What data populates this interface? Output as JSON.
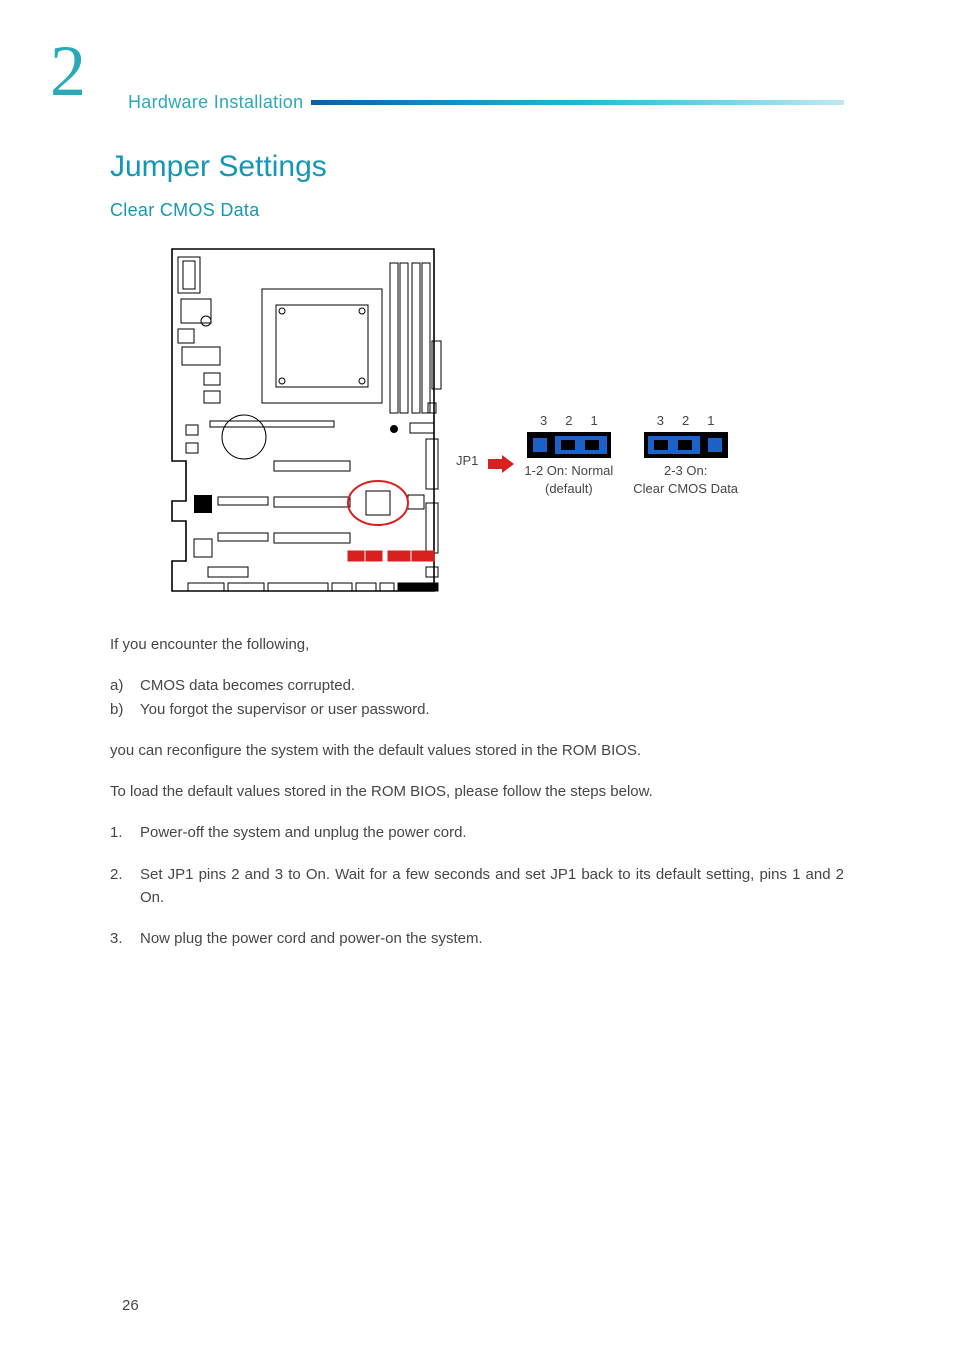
{
  "chapter": {
    "number": "2",
    "small_title": "Hardware Installation"
  },
  "headings": {
    "h1": "Jumper Settings",
    "h2": "Clear CMOS Data"
  },
  "figure": {
    "jp1_label": "JP1",
    "pin_labels": [
      "3",
      "2",
      "1"
    ],
    "jumper_a": {
      "line1": "1-2 On: Normal",
      "line2": "(default)"
    },
    "jumper_b": {
      "line1": "2-3 On:",
      "line2": "Clear CMOS Data"
    }
  },
  "body": {
    "intro": "If you encounter the following,",
    "conditions": [
      {
        "label": "a)",
        "text": "CMOS data becomes corrupted."
      },
      {
        "label": "b)",
        "text": "You forgot the supervisor or user password."
      }
    ],
    "post_conditions": "you can reconfigure the system with the default values stored in the ROM BIOS.",
    "steps_intro": "To load the default values stored in the ROM BIOS, please follow the steps below.",
    "steps": [
      {
        "label": "1.",
        "text": "Power-off the system and unplug the power cord."
      },
      {
        "label": "2.",
        "text": "Set JP1 pins 2 and 3 to On. Wait for a few seconds and set JP1 back to its default setting, pins 1 and 2 On."
      },
      {
        "label": "3.",
        "text": "Now plug the power cord and power-on the system."
      }
    ]
  },
  "page_number": "26"
}
